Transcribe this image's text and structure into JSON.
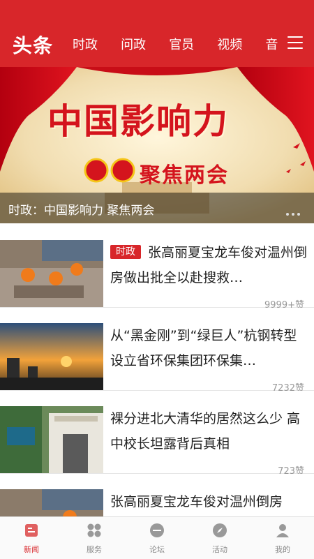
{
  "header": {
    "brand": "头条",
    "tabs": [
      "时政",
      "问政",
      "官员",
      "视频",
      "音"
    ],
    "menu_icon": "hamburger-menu-icon",
    "bg_color": "#d8262a"
  },
  "banner": {
    "headline": "中国影响力",
    "subheadline": "聚焦两会",
    "caption": "时政：中国影响力 聚焦两会"
  },
  "news": [
    {
      "badge": "时政",
      "title": "张高丽夏宝龙车俊对温州倒房做出批全以赴搜救…",
      "likes": "9999+赞"
    },
    {
      "badge": "",
      "title": "从“黑金刚”到“绿巨人”杭钢转型设立省环保集团环保集…",
      "likes": "7232赞"
    },
    {
      "badge": "",
      "title": "裸分进北大清华的居然这么少 高中校长坦露背后真相",
      "likes": "723赞"
    },
    {
      "badge": "",
      "title": "张高丽夏宝龙车俊对温州倒房",
      "likes": ""
    }
  ],
  "bottom_nav": [
    {
      "label": "新闻",
      "icon": "news-icon",
      "active": true
    },
    {
      "label": "服务",
      "icon": "grid-icon",
      "active": false
    },
    {
      "label": "论坛",
      "icon": "forum-icon",
      "active": false
    },
    {
      "label": "活动",
      "icon": "compass-icon",
      "active": false
    },
    {
      "label": "我的",
      "icon": "profile-icon",
      "active": false
    }
  ]
}
